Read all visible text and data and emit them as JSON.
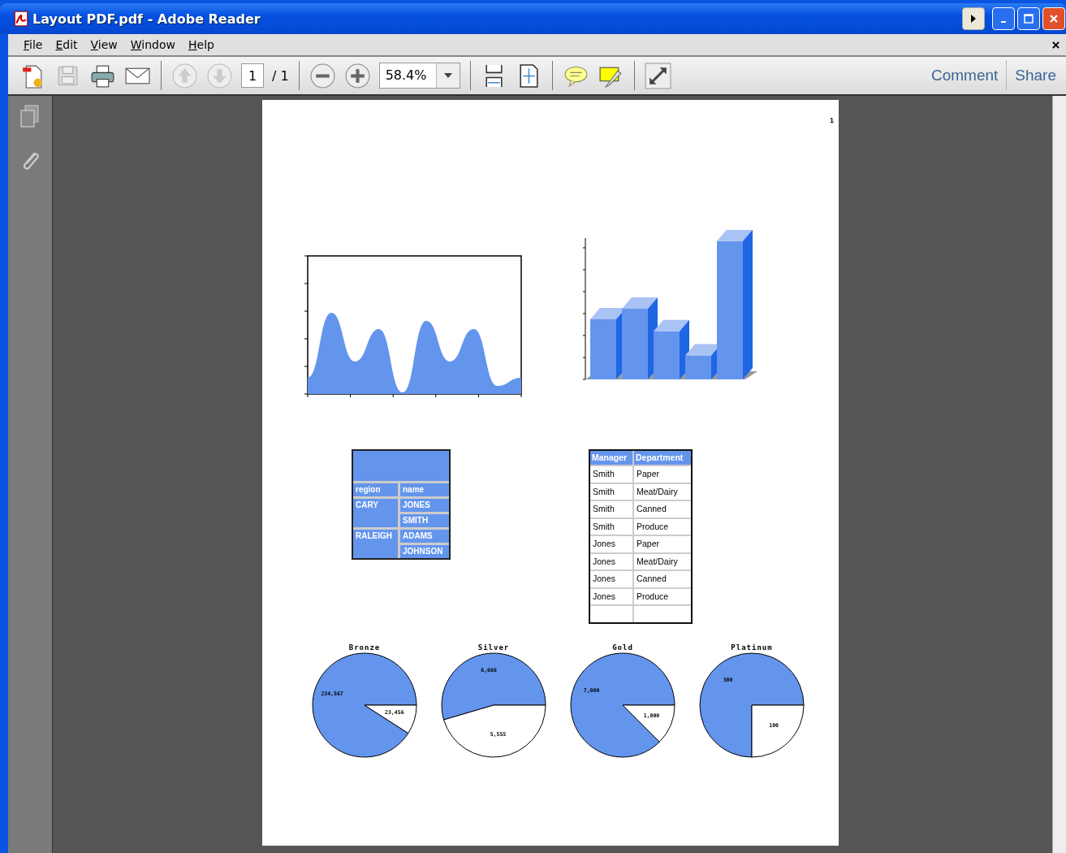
{
  "window": {
    "title": "Layout PDF.pdf - Adobe Reader"
  },
  "menu": [
    "File",
    "Edit",
    "View",
    "Window",
    "Help"
  ],
  "toolbar": {
    "page_field": "1",
    "page_total": "/ 1",
    "zoom": "58.4%",
    "links": [
      "Comment",
      "Share"
    ]
  },
  "page": {
    "page_number": "1",
    "region_table": {
      "columns": [
        "region",
        "name"
      ],
      "groups": [
        {
          "region": "CARY",
          "names": [
            "JONES",
            "SMITH"
          ]
        },
        {
          "region": "RALEIGH",
          "names": [
            "ADAMS",
            "JOHNSON"
          ]
        }
      ]
    },
    "manager_table": {
      "columns": [
        "Manager",
        "Department"
      ],
      "rows": [
        [
          "Smith",
          "Paper"
        ],
        [
          "Smith",
          "Meat/Dairy"
        ],
        [
          "Smith",
          "Canned"
        ],
        [
          "Smith",
          "Produce"
        ],
        [
          "Jones",
          "Paper"
        ],
        [
          "Jones",
          "Meat/Dairy"
        ],
        [
          "Jones",
          "Canned"
        ],
        [
          "Jones",
          "Produce"
        ]
      ]
    },
    "pies": [
      {
        "chart_data": {
          "type": "pie",
          "title": "Bronze",
          "values": [
            234567,
            23456
          ],
          "value_labels": [
            "234,567",
            "23,456"
          ]
        }
      },
      {
        "chart_data": {
          "type": "pie",
          "title": "Silver",
          "values": [
            6666,
            5555
          ],
          "value_labels": [
            "6,666",
            "5,555"
          ]
        }
      },
      {
        "chart_data": {
          "type": "pie",
          "title": "Gold",
          "values": [
            7000,
            1000
          ],
          "value_labels": [
            "7,000",
            "1,000"
          ]
        }
      },
      {
        "chart_data": {
          "type": "pie",
          "title": "Platinum",
          "values": [
            300,
            100
          ],
          "value_labels": [
            "300",
            "100"
          ]
        }
      }
    ]
  }
}
